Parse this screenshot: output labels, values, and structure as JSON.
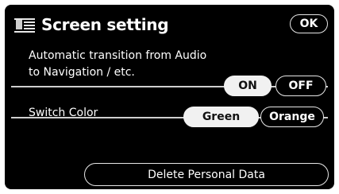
{
  "header": {
    "title": "Screen setting",
    "ok_label": "OK",
    "icon": "screen-setting-icon"
  },
  "transition": {
    "label_line1": "Automatic transition from Audio",
    "label_line2": "to Navigation / etc.",
    "on_label": "ON",
    "off_label": "OFF",
    "selected": "ON"
  },
  "switch_color": {
    "label": "Switch Color",
    "green_label": "Green",
    "orange_label": "Orange",
    "selected": "Green"
  },
  "delete_label": "Delete Personal Data",
  "colors": {
    "background": "#000000",
    "text": "#ffffff",
    "selected_fill": "#f1f1f1"
  }
}
